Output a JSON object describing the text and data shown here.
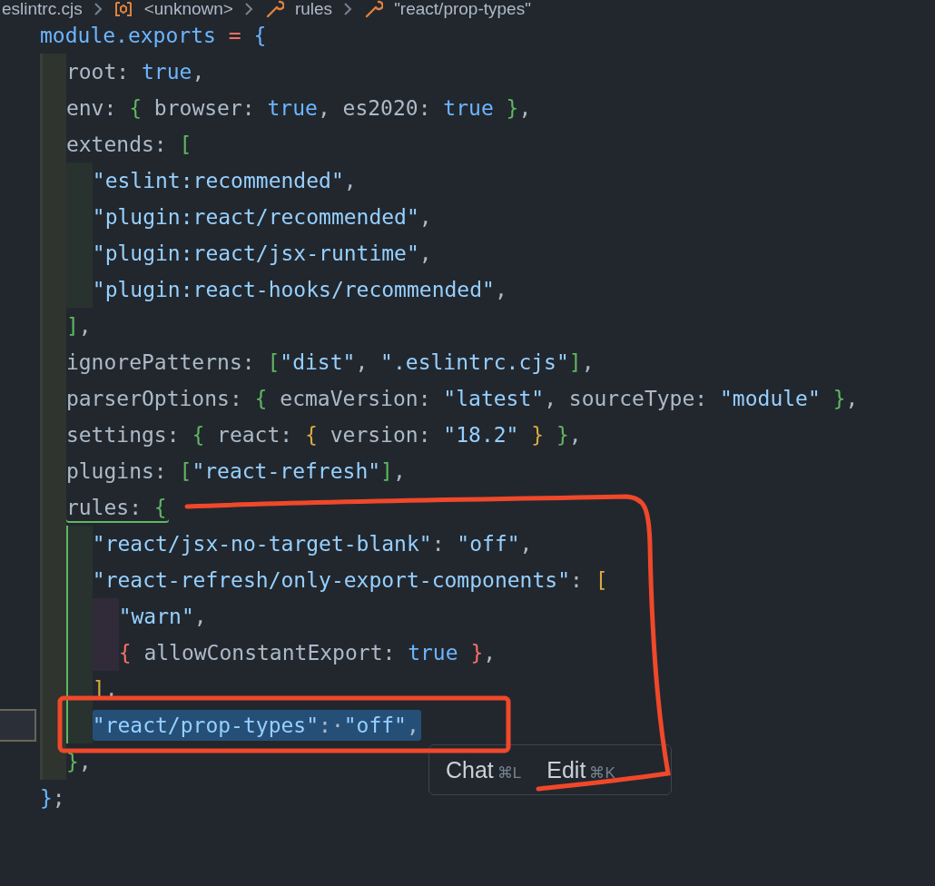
{
  "breadcrumb": [
    {
      "kind": "file",
      "label": "eslintrc.cjs"
    },
    {
      "kind": "module",
      "label": "<unknown>"
    },
    {
      "kind": "property",
      "label": "rules"
    },
    {
      "kind": "property",
      "label": "\"react/prop-types\""
    }
  ],
  "lines": [
    {
      "selected": false,
      "active": false,
      "tokens": [
        {
          "kind": "ident",
          "text": "module.exports"
        },
        {
          "kind": "op",
          "text": " = "
        },
        {
          "kind": "open",
          "text": "{"
        }
      ],
      "children": [
        {
          "selected": false,
          "tokens": [
            {
              "kind": "text",
              "text": "root: "
            },
            {
              "kind": "bool",
              "text": "true"
            },
            {
              "kind": "text",
              "text": ","
            }
          ]
        },
        {
          "selected": false,
          "tokens": [
            {
              "kind": "text",
              "text": "env: "
            },
            {
              "kind": "open",
              "text": "{"
            },
            {
              "kind": "text",
              "text": " browser: "
            },
            {
              "kind": "bool",
              "text": "true"
            },
            {
              "kind": "text",
              "text": ", es2020: "
            },
            {
              "kind": "bool",
              "text": "true"
            },
            {
              "kind": "close",
              "text": " }"
            },
            {
              "kind": "text",
              "text": ","
            }
          ]
        },
        {
          "selected": false,
          "active": false,
          "tokens": [
            {
              "kind": "text",
              "text": "extends: "
            },
            {
              "kind": "open",
              "text": "["
            }
          ],
          "children": [
            {
              "selected": false,
              "tokens": [
                {
                  "kind": "string",
                  "text": "\"eslint:recommended\""
                },
                {
                  "kind": "text",
                  "text": ","
                }
              ]
            },
            {
              "selected": false,
              "tokens": [
                {
                  "kind": "string",
                  "text": "\"plugin:react/recommended\""
                },
                {
                  "kind": "text",
                  "text": ","
                }
              ]
            },
            {
              "selected": false,
              "tokens": [
                {
                  "kind": "string",
                  "text": "\"plugin:react/jsx-runtime\""
                },
                {
                  "kind": "text",
                  "text": ","
                }
              ]
            },
            {
              "selected": false,
              "tokens": [
                {
                  "kind": "string",
                  "text": "\"plugin:react-hooks/recommended\""
                },
                {
                  "kind": "text",
                  "text": ","
                }
              ]
            }
          ]
        },
        {
          "selected": false,
          "tokens": [
            {
              "kind": "close",
              "text": "]"
            },
            {
              "kind": "text",
              "text": ","
            }
          ]
        },
        {
          "selected": false,
          "tokens": [
            {
              "kind": "text",
              "text": "ignorePatterns: "
            },
            {
              "kind": "open",
              "text": "["
            },
            {
              "kind": "string",
              "text": "\"dist\""
            },
            {
              "kind": "text",
              "text": ", "
            },
            {
              "kind": "string",
              "text": "\".eslintrc.cjs\""
            },
            {
              "kind": "close",
              "text": "]"
            },
            {
              "kind": "text",
              "text": ","
            }
          ]
        },
        {
          "selected": false,
          "tokens": [
            {
              "kind": "text",
              "text": "parserOptions: "
            },
            {
              "kind": "open",
              "text": "{"
            },
            {
              "kind": "text",
              "text": " ecmaVersion: "
            },
            {
              "kind": "string",
              "text": "\"latest\""
            },
            {
              "kind": "text",
              "text": ", sourceType: "
            },
            {
              "kind": "string",
              "text": "\"module\""
            },
            {
              "kind": "close",
              "text": " }"
            },
            {
              "kind": "text",
              "text": ","
            }
          ]
        },
        {
          "selected": false,
          "tokens": [
            {
              "kind": "text",
              "text": "settings: "
            },
            {
              "kind": "open",
              "text": "{"
            },
            {
              "kind": "text",
              "text": " react: "
            },
            {
              "kind": "open",
              "text": "{"
            },
            {
              "kind": "text",
              "text": " version: "
            },
            {
              "kind": "string",
              "text": "\"18.2\""
            },
            {
              "kind": "close",
              "text": " }"
            },
            {
              "kind": "close",
              "text": " }"
            },
            {
              "kind": "text",
              "text": ","
            }
          ]
        },
        {
          "selected": false,
          "tokens": [
            {
              "kind": "text",
              "text": "plugins: "
            },
            {
              "kind": "open",
              "text": "["
            },
            {
              "kind": "string",
              "text": "\"react-refresh\""
            },
            {
              "kind": "close",
              "text": "]"
            },
            {
              "kind": "text",
              "text": ","
            }
          ]
        },
        {
          "selected": false,
          "active": true,
          "tokens": [
            {
              "kind": "text",
              "text": "rules: "
            },
            {
              "kind": "open",
              "text": "{"
            }
          ],
          "children": [
            {
              "selected": false,
              "tokens": [
                {
                  "kind": "string",
                  "text": "\"react/jsx-no-target-blank\""
                },
                {
                  "kind": "text",
                  "text": ": "
                },
                {
                  "kind": "string",
                  "text": "\"off\""
                },
                {
                  "kind": "text",
                  "text": ","
                }
              ]
            },
            {
              "selected": false,
              "active": false,
              "tokens": [
                {
                  "kind": "string",
                  "text": "\"react-refresh/only-export-components\""
                },
                {
                  "kind": "text",
                  "text": ": "
                },
                {
                  "kind": "open",
                  "text": "["
                }
              ],
              "children": [
                {
                  "selected": false,
                  "tokens": [
                    {
                      "kind": "string",
                      "text": "\"warn\""
                    },
                    {
                      "kind": "text",
                      "text": ","
                    }
                  ]
                },
                {
                  "selected": false,
                  "tokens": [
                    {
                      "kind": "open",
                      "text": "{"
                    },
                    {
                      "kind": "text",
                      "text": " allowConstantExport: "
                    },
                    {
                      "kind": "bool",
                      "text": "true"
                    },
                    {
                      "kind": "close",
                      "text": " }"
                    },
                    {
                      "kind": "text",
                      "text": ","
                    }
                  ]
                }
              ]
            },
            {
              "selected": false,
              "tokens": [
                {
                  "kind": "close",
                  "text": "]"
                },
                {
                  "kind": "text",
                  "text": ","
                }
              ]
            },
            {
              "selected": true,
              "tokens": [
                {
                  "kind": "string",
                  "text": "\"react/prop-types\""
                },
                {
                  "kind": "text",
                  "text": ":·"
                },
                {
                  "kind": "string",
                  "text": "\"off\""
                },
                {
                  "kind": "text",
                  "text": ","
                }
              ]
            }
          ]
        },
        {
          "selected": false,
          "tokens": [
            {
              "kind": "close",
              "text": "}"
            },
            {
              "kind": "text",
              "text": ","
            }
          ]
        }
      ]
    },
    {
      "selected": false,
      "tokens": [
        {
          "kind": "close",
          "text": "}"
        },
        {
          "kind": "text",
          "text": ";"
        }
      ]
    }
  ],
  "popup": {
    "actions": [
      {
        "label": "Chat",
        "shortcut": "⌘L"
      },
      {
        "label": "Edit",
        "shortcut": "⌘K"
      }
    ]
  },
  "annotations": {
    "freehand_stroke": true,
    "box": true
  }
}
